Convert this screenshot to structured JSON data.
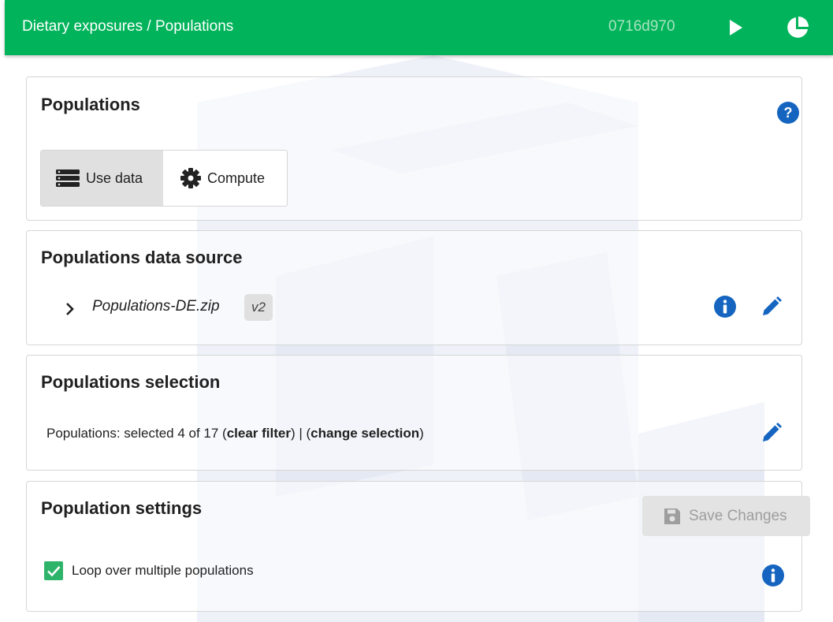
{
  "header": {
    "title": "Dietary exposures / Populations",
    "hash": "0716d970",
    "run_icon": "play-icon",
    "chart_icon": "pie-chart-icon"
  },
  "populations_card": {
    "title": "Populations",
    "help_icon": "help-icon",
    "toggle": {
      "use_data_label": "Use data",
      "compute_label": "Compute",
      "selected": "Use data"
    }
  },
  "source_card": {
    "title": "Populations data source",
    "filename": "Populations-DE.zip",
    "version": "v2"
  },
  "selection_card": {
    "title": "Populations selection",
    "prefix": "Populations: selected 4 of 17 (",
    "clear_filter": "clear filter",
    "separator": ") | (",
    "change_selection": "change selection",
    "suffix": ")"
  },
  "settings_card": {
    "title": "Population settings",
    "save_label": "Save Changes",
    "save_enabled": false,
    "loop_label": "Loop over multiple populations",
    "loop_checked": true
  },
  "colors": {
    "header_bg": "#01b35a",
    "accent_blue": "#1565c0",
    "checkbox": "#2eb46a"
  }
}
